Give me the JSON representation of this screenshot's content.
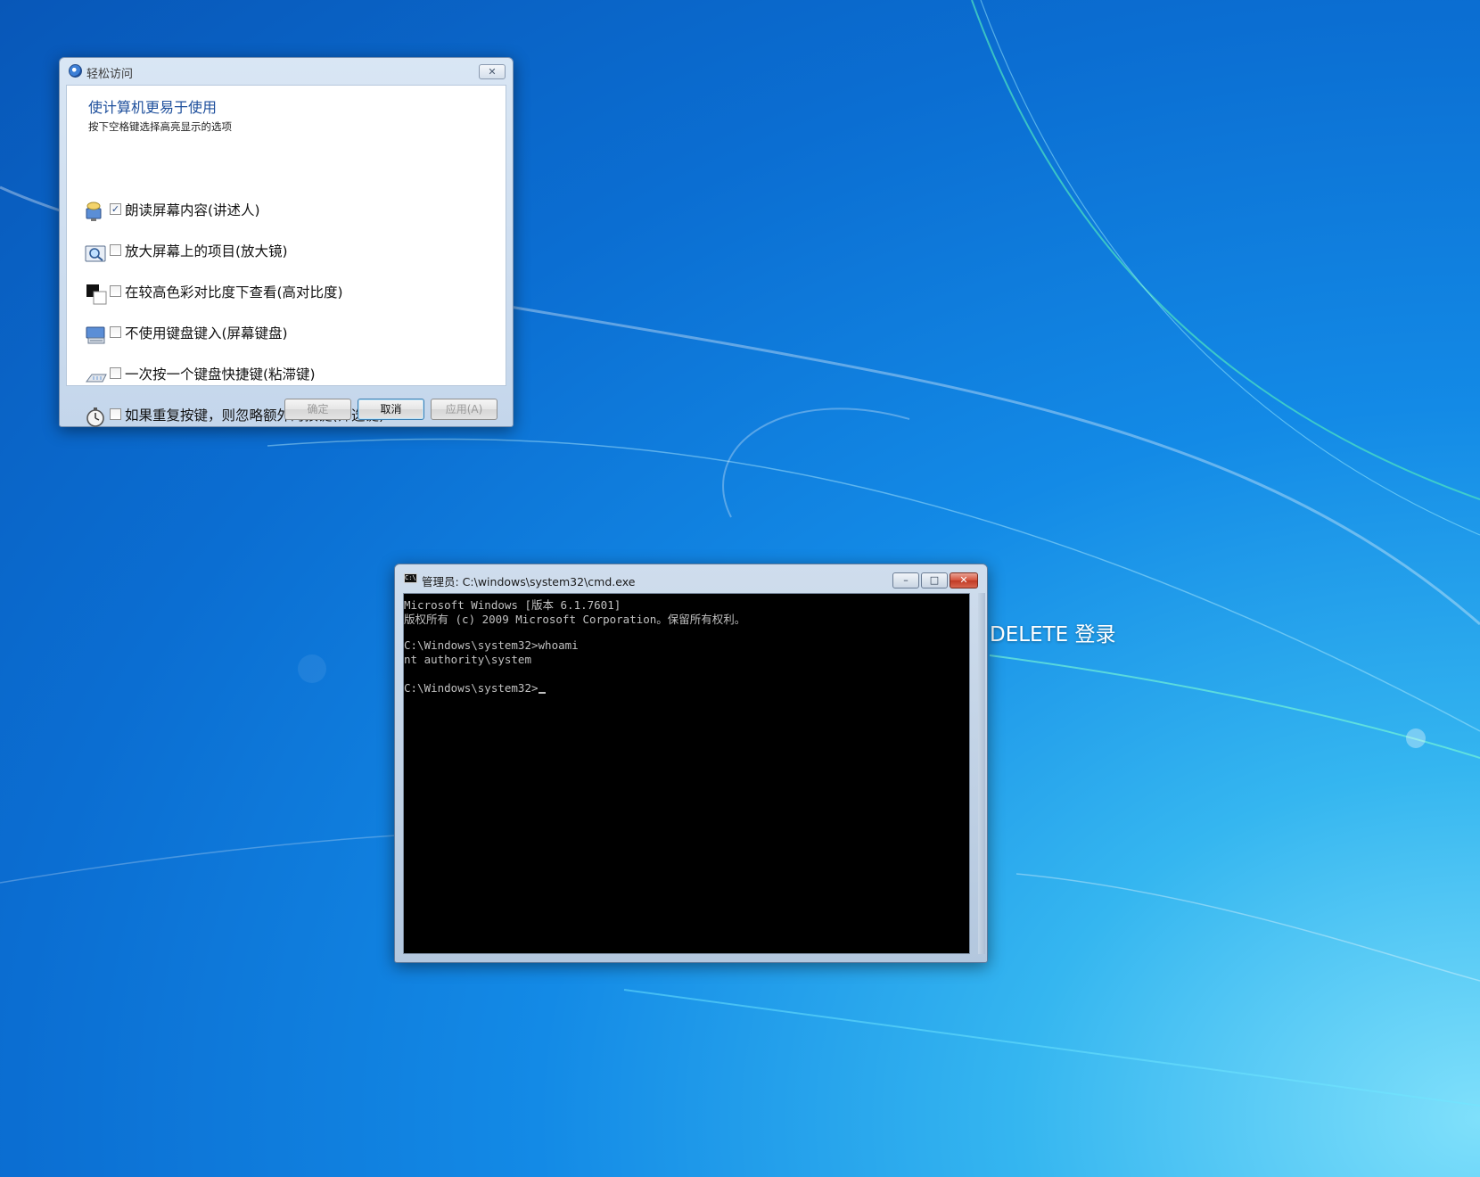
{
  "desktop": {
    "login_hint": "DELETE 登录"
  },
  "ease_dialog": {
    "title": "轻松访问",
    "close_symbol": "✕",
    "heading": "使计算机更易于使用",
    "subtitle": "按下空格键选择高亮显示的选项",
    "options": [
      {
        "label": "朗读屏幕内容(讲述人)",
        "checked": true,
        "icon": "narrator-icon"
      },
      {
        "label": "放大屏幕上的项目(放大镜)",
        "checked": false,
        "icon": "magnifier-icon"
      },
      {
        "label": "在较高色彩对比度下查看(高对比度)",
        "checked": false,
        "icon": "high-contrast-icon"
      },
      {
        "label": "不使用键盘键入(屏幕键盘)",
        "checked": false,
        "icon": "on-screen-keyboard-icon"
      },
      {
        "label": "一次按一个键盘快捷键(粘滞键)",
        "checked": false,
        "icon": "sticky-keys-icon"
      },
      {
        "label": "如果重复按键，则忽略额外的按键(筛选键)",
        "checked": false,
        "icon": "filter-keys-icon"
      }
    ],
    "buttons": {
      "ok": "确定",
      "cancel": "取消",
      "apply": "应用(A)"
    }
  },
  "cmd_window": {
    "title": "管理员: C:\\windows\\system32\\cmd.exe",
    "icon_text": "C:\\",
    "minimize_symbol": "–",
    "maximize_symbol": "□",
    "close_symbol": "✕",
    "lines": [
      "Microsoft Windows [版本 6.1.7601]",
      "版权所有 (c) 2009 Microsoft Corporation。保留所有权利。",
      "",
      "C:\\Windows\\system32>whoami",
      "nt authority\\system",
      "",
      "C:\\Windows\\system32>"
    ]
  },
  "colors": {
    "accent_blue": "#1e4f9c",
    "console_bg": "#000000",
    "console_text": "#c0c0c0"
  }
}
